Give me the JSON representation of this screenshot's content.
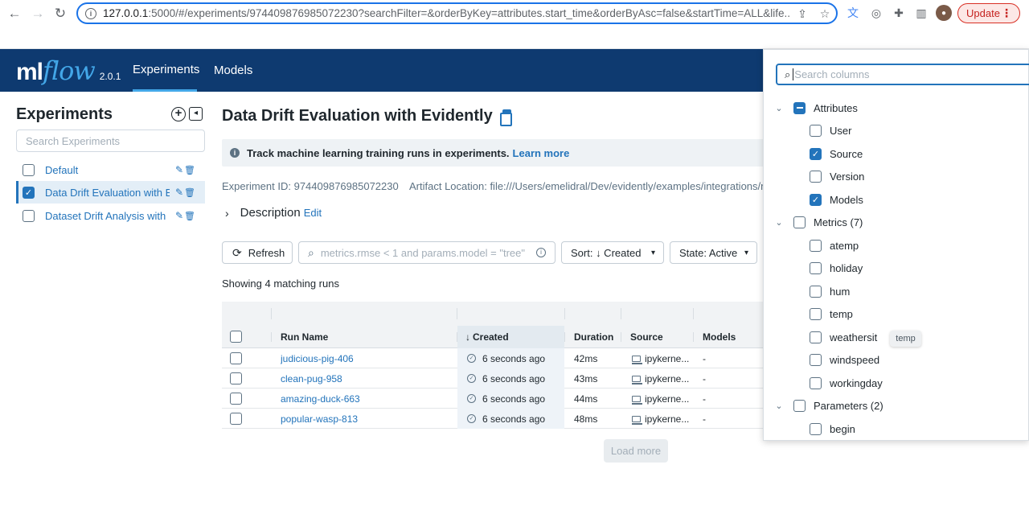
{
  "browser": {
    "url_host": "127.0.0.1",
    "url_rest": ":5000/#/experiments/974409876985072230?searchFilter=&orderByKey=attributes.start_time&orderByAsc=false&startTime=ALL&life...",
    "update_label": "Update"
  },
  "appbar": {
    "logo_ml": "ml",
    "logo_flow": "flow",
    "version": "2.0.1",
    "tabs": [
      "Experiments",
      "Models"
    ]
  },
  "sidebar": {
    "title": "Experiments",
    "search_placeholder": "Search Experiments",
    "items": [
      {
        "label": "Default",
        "checked": false
      },
      {
        "label": "Data Drift Evaluation with E...",
        "checked": true
      },
      {
        "label": "Dataset Drift Analysis with ...",
        "checked": false
      }
    ]
  },
  "main": {
    "title": "Data Drift Evaluation with Evidently",
    "banner_text": "Track machine learning training runs in experiments.",
    "banner_link": "Learn more",
    "experiment_id": "Experiment ID: 974409876985072230",
    "artifact_location": "Artifact Location: file:///Users/emelidral/Dev/evidently/examples/integrations/mlflow",
    "description_label": "Description",
    "description_edit": "Edit",
    "refresh_label": "Refresh",
    "search_placeholder": "metrics.rmse < 1 and params.model = \"tree\"",
    "sort_label": "Sort: ↓ Created",
    "state_label": "State: Active",
    "showing_text": "Showing 4 matching runs",
    "load_more": "Load more"
  },
  "table": {
    "headers": {
      "run_name": "Run Name",
      "created": "Created",
      "duration": "Duration",
      "source": "Source",
      "models": "Models"
    },
    "rows": [
      {
        "run_name": "judicious-pig-406",
        "created": "6 seconds ago",
        "duration": "42ms",
        "source": "ipykerne...",
        "models": "-"
      },
      {
        "run_name": "clean-pug-958",
        "created": "6 seconds ago",
        "duration": "43ms",
        "source": "ipykerne...",
        "models": "-"
      },
      {
        "run_name": "amazing-duck-663",
        "created": "6 seconds ago",
        "duration": "44ms",
        "source": "ipykerne...",
        "models": "-"
      },
      {
        "run_name": "popular-wasp-813",
        "created": "6 seconds ago",
        "duration": "48ms",
        "source": "ipykerne...",
        "models": "-"
      }
    ]
  },
  "columns_dropdown": {
    "search_placeholder": "Search columns",
    "attributes_label": "Attributes",
    "attributes": [
      {
        "label": "User",
        "checked": false
      },
      {
        "label": "Source",
        "checked": true
      },
      {
        "label": "Version",
        "checked": false
      },
      {
        "label": "Models",
        "checked": true
      }
    ],
    "metrics_label": "Metrics (7)",
    "metrics": [
      "atemp",
      "holiday",
      "hum",
      "temp",
      "weathersit",
      "windspeed",
      "workingday"
    ],
    "params_label": "Parameters (2)",
    "params": [
      "begin"
    ],
    "tooltip": "temp"
  },
  "colors": {
    "brand_nav": "#0e3a70",
    "accent": "#2374bb",
    "flow_blue": "#43a7e8"
  }
}
